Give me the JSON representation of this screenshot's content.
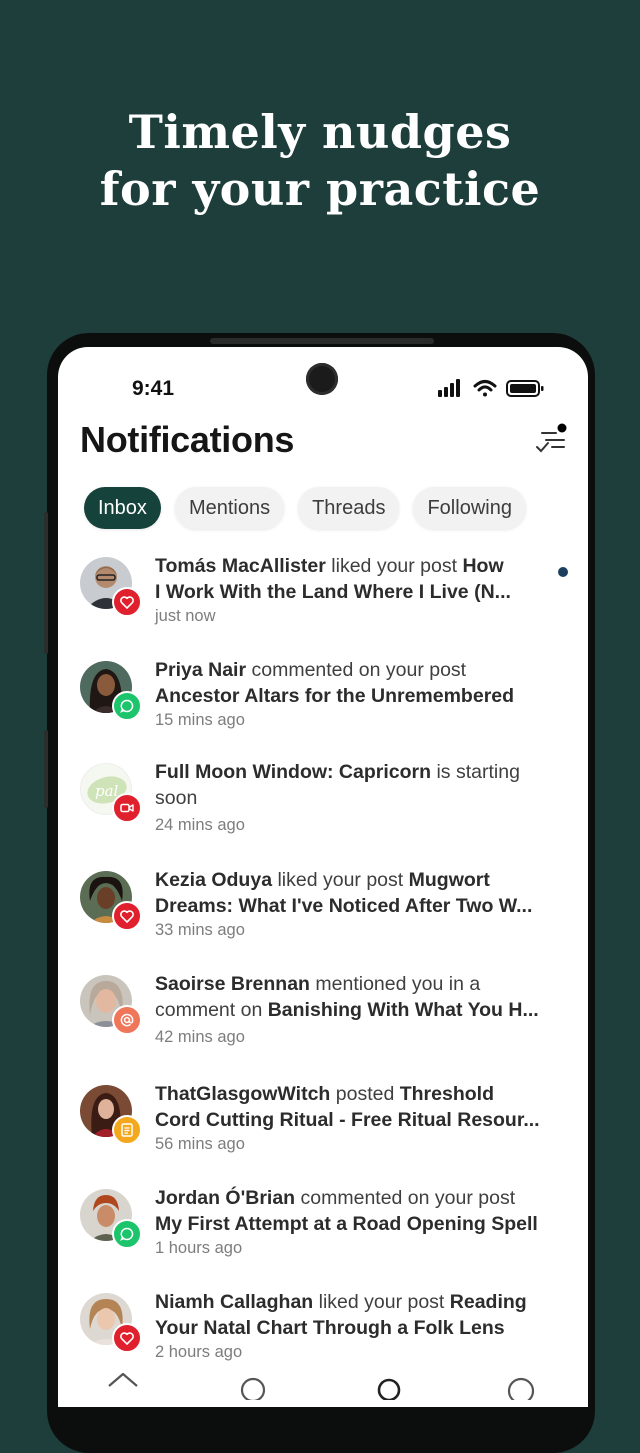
{
  "headline": {
    "line1": "Timely nudges",
    "line2": "for your practice"
  },
  "status_bar": {
    "time": "9:41"
  },
  "page": {
    "title": "Notifications"
  },
  "tabs": [
    {
      "label": "Inbox",
      "active": true
    },
    {
      "label": "Mentions",
      "active": false
    },
    {
      "label": "Threads",
      "active": false
    },
    {
      "label": "Following",
      "active": false
    }
  ],
  "notifications": [
    {
      "actor": "Tomás MacAllister",
      "action": " liked your post ",
      "target": "How",
      "line2": "I Work With the Land Where I Live (N...",
      "time": "just now",
      "badge": "heart",
      "unread": true
    },
    {
      "actor": "Priya Nair",
      "action": " commented on your post",
      "line2": "Ancestor Altars for the Unremembered",
      "time": "15 mins ago",
      "badge": "comment"
    },
    {
      "subject": "Full Moon Window: Capricorn",
      "action": " is starting",
      "line2": "soon",
      "time": "24 mins ago",
      "badge": "video",
      "avatar_text": "pal"
    },
    {
      "actor": "Kezia Oduya",
      "action": " liked your post ",
      "target": "Mugwort",
      "line2": "Dreams: What I've Noticed After Two W...",
      "time": "33 mins ago",
      "badge": "heart"
    },
    {
      "actor": "Saoirse Brennan",
      "action": " mentioned you in a",
      "line2_prefix": "comment on ",
      "line2": "Banishing With What You H...",
      "time": "42 mins ago",
      "badge": "mention"
    },
    {
      "actor": "ThatGlasgowWitch",
      "action": " posted ",
      "target": "Threshold",
      "line2": "Cord Cutting Ritual - Free Ritual Resour...",
      "time": "56 mins ago",
      "badge": "post"
    },
    {
      "actor": "Jordan Ó'Brian",
      "action": " commented on your post",
      "line2": "My First Attempt at a Road Opening Spell",
      "time": "1 hours ago",
      "badge": "comment"
    },
    {
      "actor": "Niamh Callaghan",
      "action": " liked your post ",
      "target": "Reading",
      "line2": "Your Natal Chart Through a Folk Lens",
      "time": "2 hours ago",
      "badge": "heart"
    }
  ],
  "colors": {
    "background": "#1d3e3b",
    "tab_active": "#16423c",
    "heart_badge": "#e0202c",
    "comment_badge": "#1cc46b",
    "mention_badge": "#f0765a",
    "post_badge": "#f3a81e",
    "unread_dot": "#1b3f5f"
  },
  "icons": {
    "filter": "filter-check-icon",
    "heart": "heart-icon",
    "comment": "comment-bubble-icon",
    "video": "video-camera-icon",
    "mention": "at-sign-icon",
    "post": "document-icon"
  }
}
